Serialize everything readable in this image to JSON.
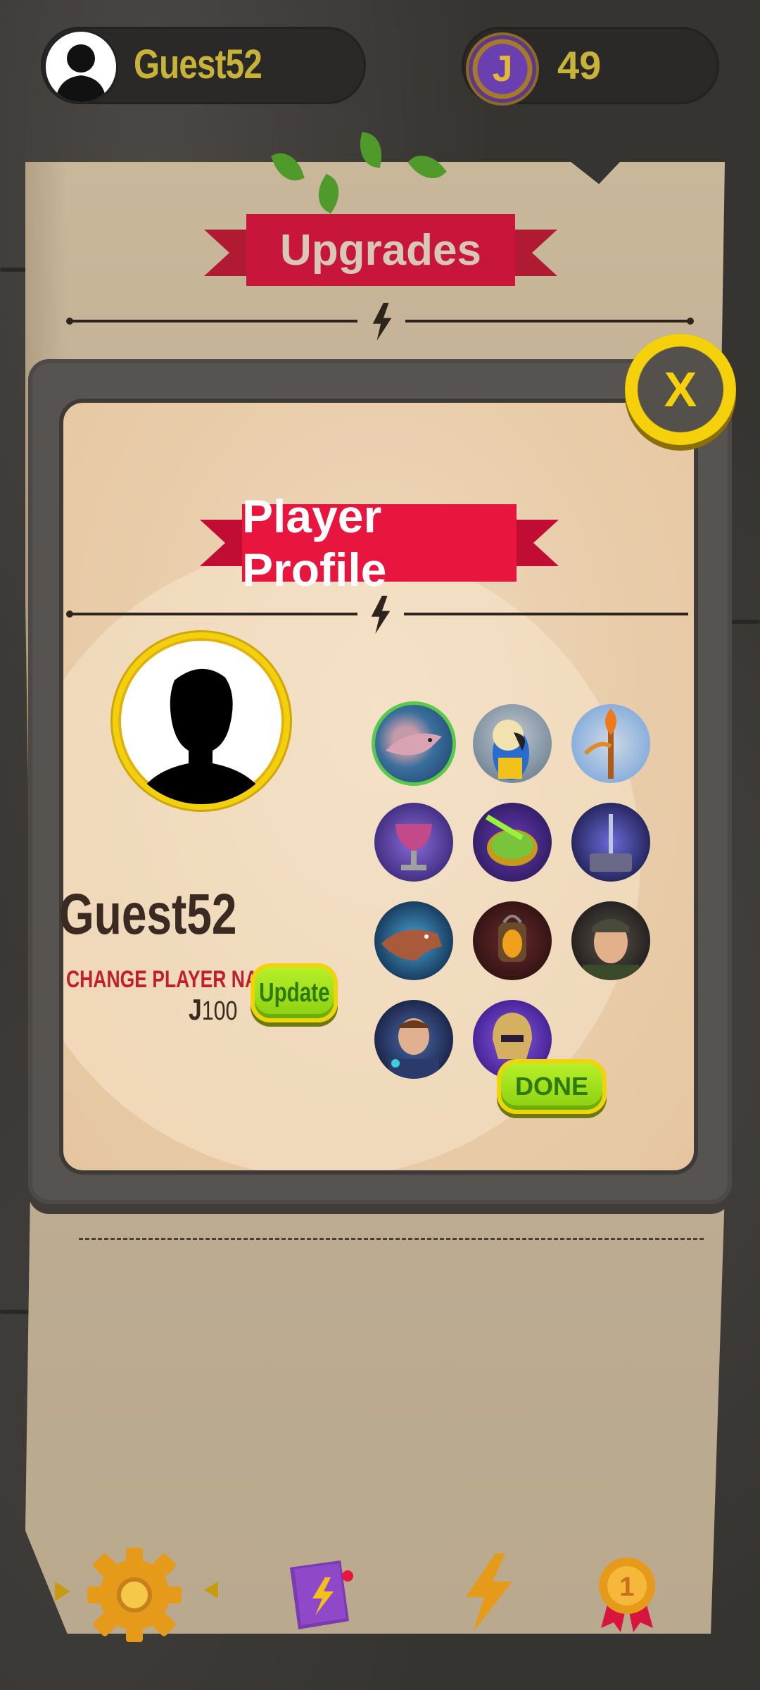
{
  "top_bar": {
    "username": "Guest52",
    "coins": "49",
    "coin_symbol": "J"
  },
  "upgrades": {
    "title": "Upgrades"
  },
  "modal": {
    "title": "Player Profile",
    "player_name": "Guest52",
    "change_name_label": "CHANGE PLAYER NAME",
    "cost_symbol": "J",
    "cost_value": "100",
    "update_label": "Update",
    "done_label": "DONE",
    "close_label": "X"
  },
  "avatars": [
    {
      "name": "shark",
      "selected": true
    },
    {
      "name": "parrot",
      "selected": false
    },
    {
      "name": "fire-staff",
      "selected": false
    },
    {
      "name": "goblet",
      "selected": false
    },
    {
      "name": "green-coin",
      "selected": false
    },
    {
      "name": "hammer",
      "selected": false
    },
    {
      "name": "dinosaur",
      "selected": false
    },
    {
      "name": "lantern",
      "selected": false
    },
    {
      "name": "soldier",
      "selected": false
    },
    {
      "name": "space-boy",
      "selected": false
    },
    {
      "name": "knight-helmet",
      "selected": false
    }
  ],
  "bottom_nav": [
    {
      "name": "settings-gear",
      "active": true
    },
    {
      "name": "spell-book"
    },
    {
      "name": "lightning"
    },
    {
      "name": "rank-medal",
      "badge": "1"
    }
  ],
  "colors": {
    "gold_text": "#c8b33a",
    "ribbon_red": "#e8153f",
    "green_button": "#8ad010"
  }
}
